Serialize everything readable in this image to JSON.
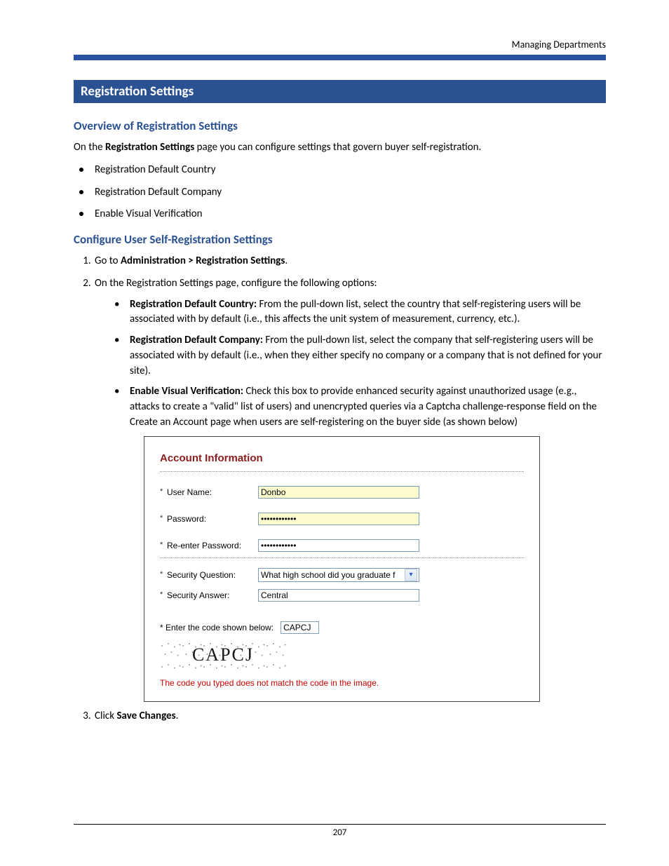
{
  "header_right": "Managing Departments",
  "section_title": "Registration Settings",
  "overview_heading": "Overview of Registration Settings",
  "overview_intro_pre": "On the ",
  "overview_intro_bold": "Registration Settings",
  "overview_intro_post": " page you can configure settings that govern buyer self-registration.",
  "feature_bullets": [
    "Registration Default Country",
    "Registration Default Company",
    "Enable Visual Verification"
  ],
  "configure_heading": "Configure User Self-Registration Settings",
  "step1_pre": "Go to ",
  "step1_bold": "Administration > Registration Settings",
  "step1_post": ".",
  "step2_text": "On the Registration Settings page, configure the following options:",
  "opt1_label": "Registration Default Country:",
  "opt1_text": " From the pull-down list, select the country that self-registering users will be associated with by default (i.e., this affects the unit system of measurement, currency, etc.).",
  "opt2_label": "Registration Default Company:",
  "opt2_text": " From the pull-down list, select the company that self-registering users will be associated with by default (i.e., when they either specify no company or a company that is not defined for your site).",
  "opt3_label": "Enable Visual Verification:",
  "opt3_text": " Check this box to provide enhanced security against unauthorized usage (e.g., attacks to create a \"valid\" list of users) and unencrypted queries via a Captcha challenge-response field on the Create an Account page when users are self-registering on the buyer side (as shown below)",
  "step3_pre": "Click ",
  "step3_bold": "Save Changes",
  "step3_post": ".",
  "screenshot": {
    "title": "Account Information",
    "req_mark": "*",
    "labels": {
      "username": "User Name:",
      "password": "Password:",
      "repassword": "Re-enter Password:",
      "secq": "Security Question:",
      "seca": "Security Answer:",
      "captcha_prompt": "* Enter the code shown below:"
    },
    "values": {
      "username": "Donbo",
      "password": "••••••••••••",
      "repassword": "••••••••••••",
      "secq": "What high school did you graduate f",
      "seca": "Central",
      "captcha_input": "CAPCJ",
      "captcha_image_text": "CAPCJ"
    },
    "error": "The code you typed does not match the code in the image."
  },
  "page_number": "207"
}
